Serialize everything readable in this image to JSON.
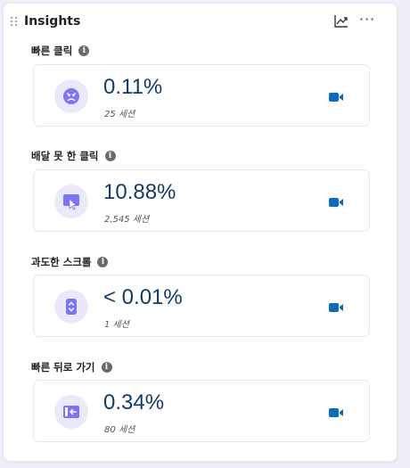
{
  "panel": {
    "title": "Insights",
    "more_label": "···"
  },
  "colors": {
    "accent": "#7b74f5",
    "icon_bg": "#e8e9fb",
    "value": "#123b66",
    "video": "#0f6cbd"
  },
  "insights": [
    {
      "label": "빠른 클릭",
      "value": "0.11%",
      "sessions": "25 세션",
      "icon": "angry-face-icon"
    },
    {
      "label": "배달 못 한 클릭",
      "value": "10.88%",
      "sessions": "2,545 세션",
      "icon": "dead-click-icon"
    },
    {
      "label": "과도한 스크롤",
      "value": "< 0.01%",
      "sessions": "1 세션",
      "icon": "scroll-icon"
    },
    {
      "label": "빠른 뒤로 가기",
      "value": "0.34%",
      "sessions": "80 세션",
      "icon": "back-arrow-icon"
    }
  ]
}
